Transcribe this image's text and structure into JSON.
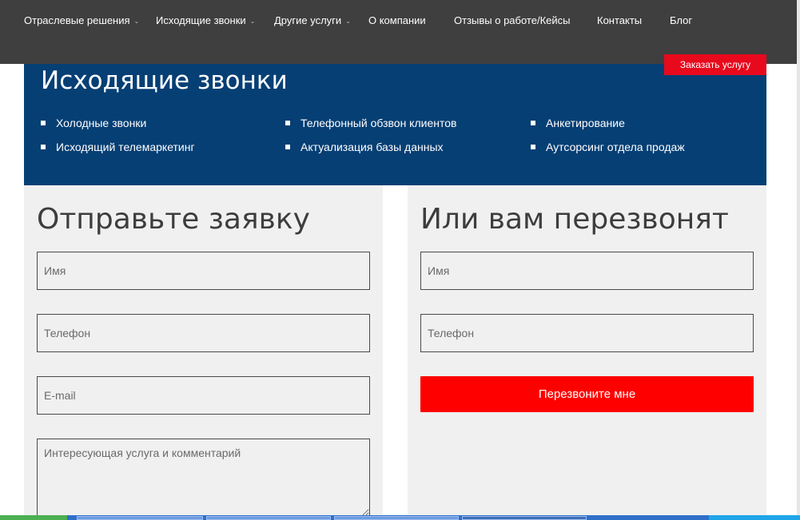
{
  "nav": {
    "items": [
      {
        "label": "Отраслевые решения",
        "has_dropdown": true
      },
      {
        "label": "Исходящие звонки",
        "has_dropdown": true
      },
      {
        "label": "Другие услуги",
        "has_dropdown": true
      },
      {
        "label": "О компании",
        "has_dropdown": false
      },
      {
        "label": "Отзывы о работе/Кейсы",
        "has_dropdown": false
      },
      {
        "label": "Контакты",
        "has_dropdown": false
      },
      {
        "label": "Блог",
        "has_dropdown": false
      }
    ],
    "chevron": "⌄",
    "order_button": "Заказать услугу"
  },
  "hero": {
    "title": "Исходящие звонки",
    "services": [
      "Холодные звонки",
      "Исходящий телемаркетинг",
      "Телефонный обзвон клиентов",
      "Актуализация базы данных",
      "Анкетирование",
      "Аутсорсинг отдела продаж"
    ]
  },
  "request_form": {
    "title": "Отправьте заявку",
    "name_placeholder": "Имя",
    "phone_placeholder": "Телефон",
    "email_placeholder": "E-mail",
    "comment_placeholder": "Интересующая услуга и комментарий"
  },
  "callback_form": {
    "title": "Или вам перезвонят",
    "name_placeholder": "Имя",
    "phone_placeholder": "Телефон",
    "submit_label": "Перезвоните мне"
  },
  "colors": {
    "nav_bg": "#3f3f3f",
    "hero_bg": "#063f74",
    "accent_red": "#fe0000",
    "panel_bg": "#f0f0f0"
  }
}
